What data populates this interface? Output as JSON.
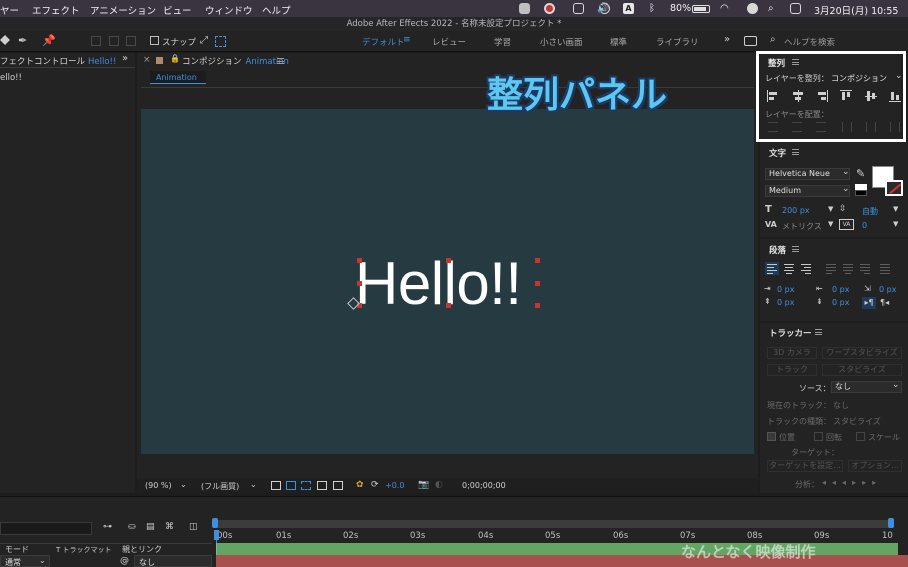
{
  "menubar": {
    "items": [
      "ヤー",
      "エフェクト",
      "アニメーション",
      "ビュー",
      "ウィンドウ",
      "ヘルプ"
    ],
    "battery": "80%",
    "datetime": "3月20日(月)  10:55",
    "input_indicator": "A"
  },
  "window_title": "Adobe After Effects 2022 - 名称未設定プロジェクト *",
  "toolbar": {
    "snap_label": "スナップ",
    "workspaces": [
      "デフォルト",
      "レビュー",
      "学習",
      "小さい画面",
      "標準",
      "ライブラリ"
    ],
    "active_workspace": "デフォルト",
    "search_placeholder": "ヘルプを検索"
  },
  "effects_panel": {
    "tab_label": "フェクトコントロール",
    "tab_layer": "Hello!!",
    "layer_row": "ello!!"
  },
  "comp_panel": {
    "tab_label": "コンポジション",
    "comp_name": "Animation",
    "breadcrumb": "Animation",
    "text_content": "Hello!!",
    "zoom": "(90 %)",
    "quality": "(フル画質)",
    "exposure": "+0.0",
    "timecode": "0;00;00;00"
  },
  "align_panel": {
    "title": "整列",
    "align_to_label": "レイヤーを整列：",
    "align_to_value": "コンポジション",
    "distribute_label": "レイヤーを配置："
  },
  "character_panel": {
    "title": "文字",
    "font": "Helvetica Neue",
    "style": "Medium",
    "size": "200 px",
    "leading": "自動",
    "kerning": "メトリクス",
    "tracking": "0"
  },
  "paragraph_panel": {
    "title": "段落",
    "indent_values": [
      "0 px",
      "0 px",
      "0 px",
      "0 px",
      "0 px"
    ]
  },
  "tracker_panel": {
    "title": "トラッカー",
    "buttons": [
      "3D カメラ",
      "ワープスタビライズ",
      "トラック",
      "スタビライズ"
    ],
    "source_label": "ソース：",
    "source_value": "なし",
    "current_track_label": "現在のトラック：",
    "current_track_value": "なし",
    "track_type_label": "トラックの種類：",
    "track_type_value": "スタビライズ",
    "position_label": "位置",
    "rotation_label": "回転",
    "scale_label": "スケール",
    "target_label": "ターゲット：",
    "set_target_button": "ターゲットを設定...",
    "options_button": "オプション...",
    "analyze_label": "分析："
  },
  "timeline": {
    "ticks": [
      "00s",
      "01s",
      "02s",
      "03s",
      "04s",
      "05s",
      "06s",
      "07s",
      "08s",
      "09s",
      "10"
    ],
    "mode_header": "モード",
    "trkmat_header": "T  トラックマット",
    "parent_header": "親とリンク",
    "mode_value": "通常",
    "parent_value": "なし"
  },
  "overlay": {
    "callout_text": "整列パネル",
    "watermark": "なんとなく映像制作"
  },
  "colors": {
    "accent_blue": "#3f8fe0",
    "comp_bg": "#263a42",
    "callout_text": "#5cc8f2",
    "handle_red": "#c8342f"
  }
}
